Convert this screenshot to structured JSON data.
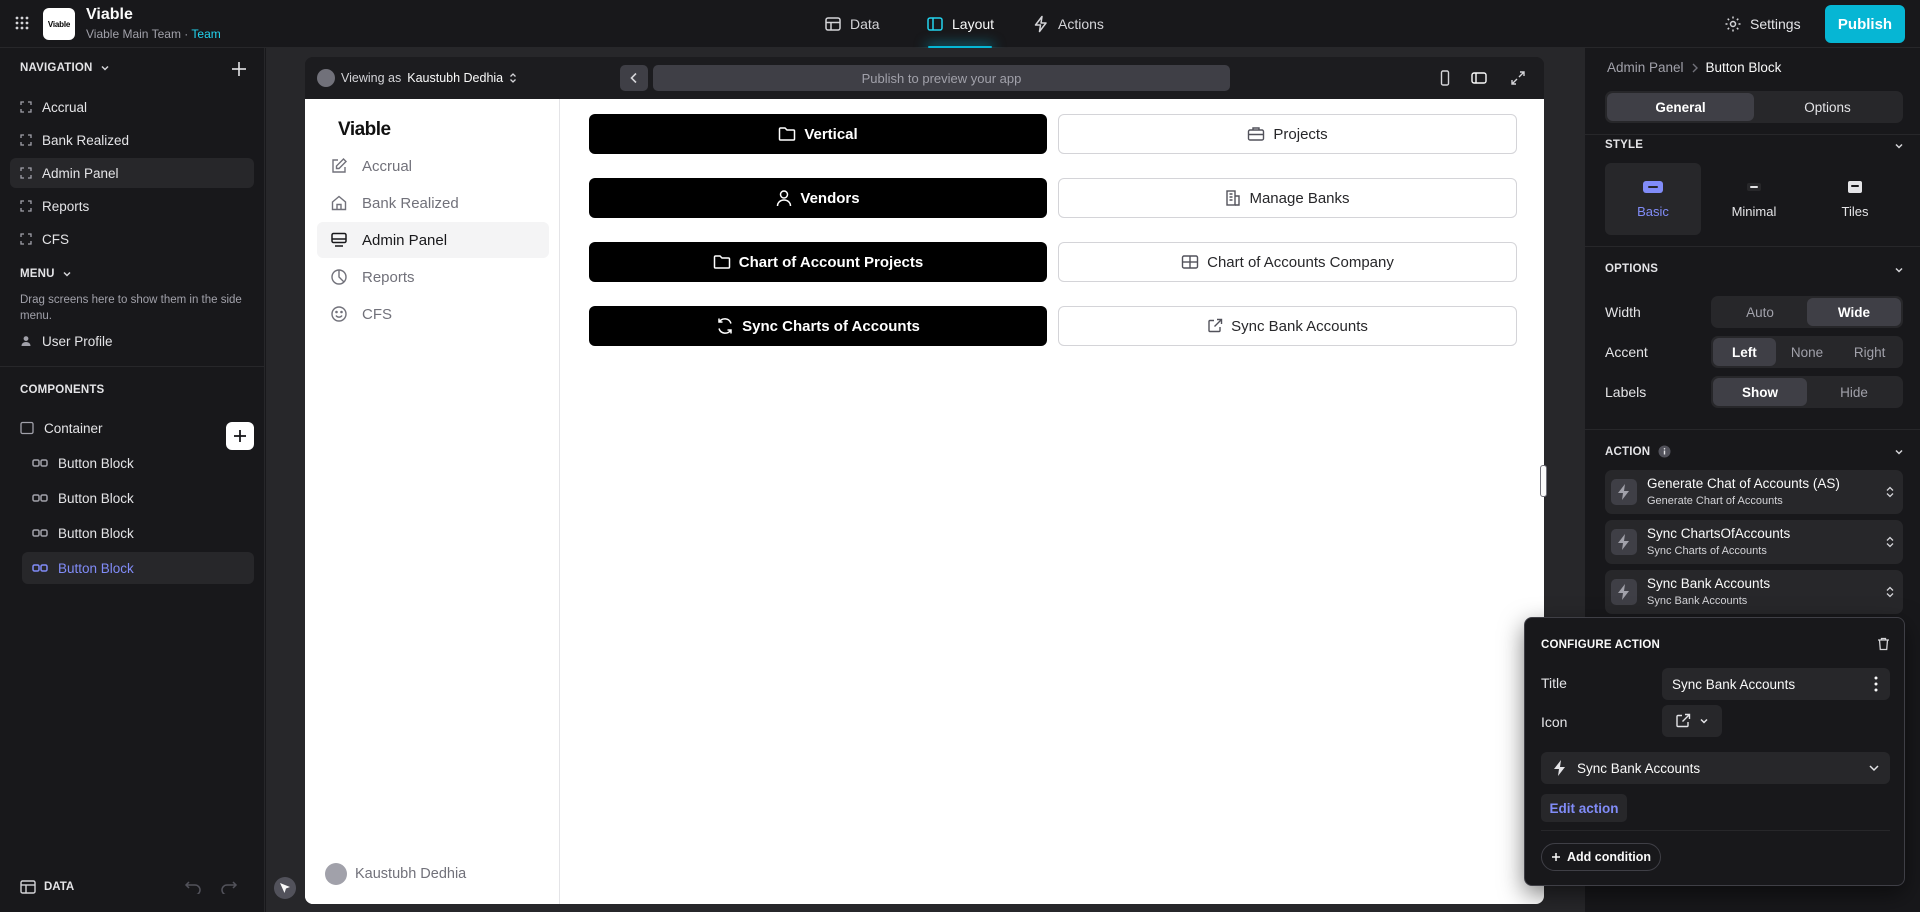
{
  "topbar": {
    "app_name": "Viable",
    "logo_text": "Viable",
    "team_line": "Viable Main Team · ",
    "team_badge": "Team",
    "nav": [
      {
        "label": "Data",
        "icon": "table-icon"
      },
      {
        "label": "Layout",
        "icon": "layout-icon"
      },
      {
        "label": "Actions",
        "icon": "bolt-icon"
      }
    ],
    "active_nav": "Layout",
    "settings_label": "Settings",
    "publish_label": "Publish",
    "accent": "#06b6d4"
  },
  "left": {
    "navigation_heading": "NAVIGATION",
    "navigation_items": [
      "Accrual",
      "Bank Realized",
      "Admin Panel",
      "Reports",
      "CFS"
    ],
    "selected_navigation": "Admin Panel",
    "menu_heading": "MENU",
    "menu_hint": "Drag screens here to show them in the side menu.",
    "menu_items": [
      "User Profile"
    ],
    "components_heading": "COMPONENTS",
    "components": [
      {
        "label": "Container"
      },
      {
        "label": "Button Block"
      },
      {
        "label": "Button Block"
      },
      {
        "label": "Button Block"
      },
      {
        "label": "Button Block",
        "selected": true
      }
    ],
    "data_label": "DATA"
  },
  "preview": {
    "viewing_prefix": "Viewing as",
    "viewing_user": "Kaustubh Dedhia",
    "url_placeholder": "Publish to preview your app",
    "app_logo": "Viable",
    "app_nav": [
      {
        "label": "Accrual",
        "icon": "edit-icon"
      },
      {
        "label": "Bank Realized",
        "icon": "home-icon"
      },
      {
        "label": "Admin Panel",
        "icon": "monitor-icon"
      },
      {
        "label": "Reports",
        "icon": "pie-chart-icon"
      },
      {
        "label": "CFS",
        "icon": "smile-icon"
      }
    ],
    "app_selected": "Admin Panel",
    "app_user": "Kaustubh Dedhia",
    "buttons": [
      {
        "label": "Vertical",
        "style": "dark",
        "icon": "folder-icon"
      },
      {
        "label": "Projects",
        "style": "light",
        "icon": "briefcase-icon"
      },
      {
        "label": "Vendors",
        "style": "dark",
        "icon": "user-icon"
      },
      {
        "label": "Manage Banks",
        "style": "light",
        "icon": "building-icon"
      },
      {
        "label": "Chart of Account Projects",
        "style": "dark",
        "icon": "folder-icon"
      },
      {
        "label": "Chart of Accounts Company",
        "style": "light",
        "icon": "table-icon"
      },
      {
        "label": "Sync Charts of Accounts",
        "style": "dark",
        "icon": "refresh-icon"
      },
      {
        "label": "Sync Bank Accounts",
        "style": "light",
        "icon": "external-link-icon"
      }
    ]
  },
  "right": {
    "breadcrumb_parent": "Admin Panel",
    "breadcrumb_current": "Button Block",
    "tabs": [
      "General",
      "Options"
    ],
    "active_tab": "General",
    "style_heading": "STYLE",
    "style_options": [
      "Basic",
      "Minimal",
      "Tiles"
    ],
    "style_selected": "Basic",
    "options_heading": "OPTIONS",
    "width_label": "Width",
    "width_options": [
      "Auto",
      "Wide"
    ],
    "width_selected": "Wide",
    "accent_label": "Accent",
    "accent_options": [
      "Left",
      "None",
      "Right"
    ],
    "accent_selected": "Left",
    "labels_label": "Labels",
    "labels_options": [
      "Show",
      "Hide"
    ],
    "labels_selected": "Show",
    "action_heading": "ACTION",
    "actions": [
      {
        "title": "Generate Chat of Accounts (AS)",
        "subtitle": "Generate Chart of Accounts"
      },
      {
        "title": "Sync ChartsOfAccounts",
        "subtitle": "Sync Charts of Accounts"
      },
      {
        "title": "Sync Bank Accounts",
        "subtitle": "Sync Bank Accounts"
      }
    ],
    "highlight": "#818cf8"
  },
  "configure": {
    "heading": "CONFIGURE ACTION",
    "title_label": "Title",
    "title_value": "Sync Bank Accounts",
    "icon_label": "Icon",
    "icon_value": "external-link-icon",
    "action_value": "Sync Bank Accounts",
    "edit_action_label": "Edit action",
    "add_condition_label": "Add condition"
  }
}
